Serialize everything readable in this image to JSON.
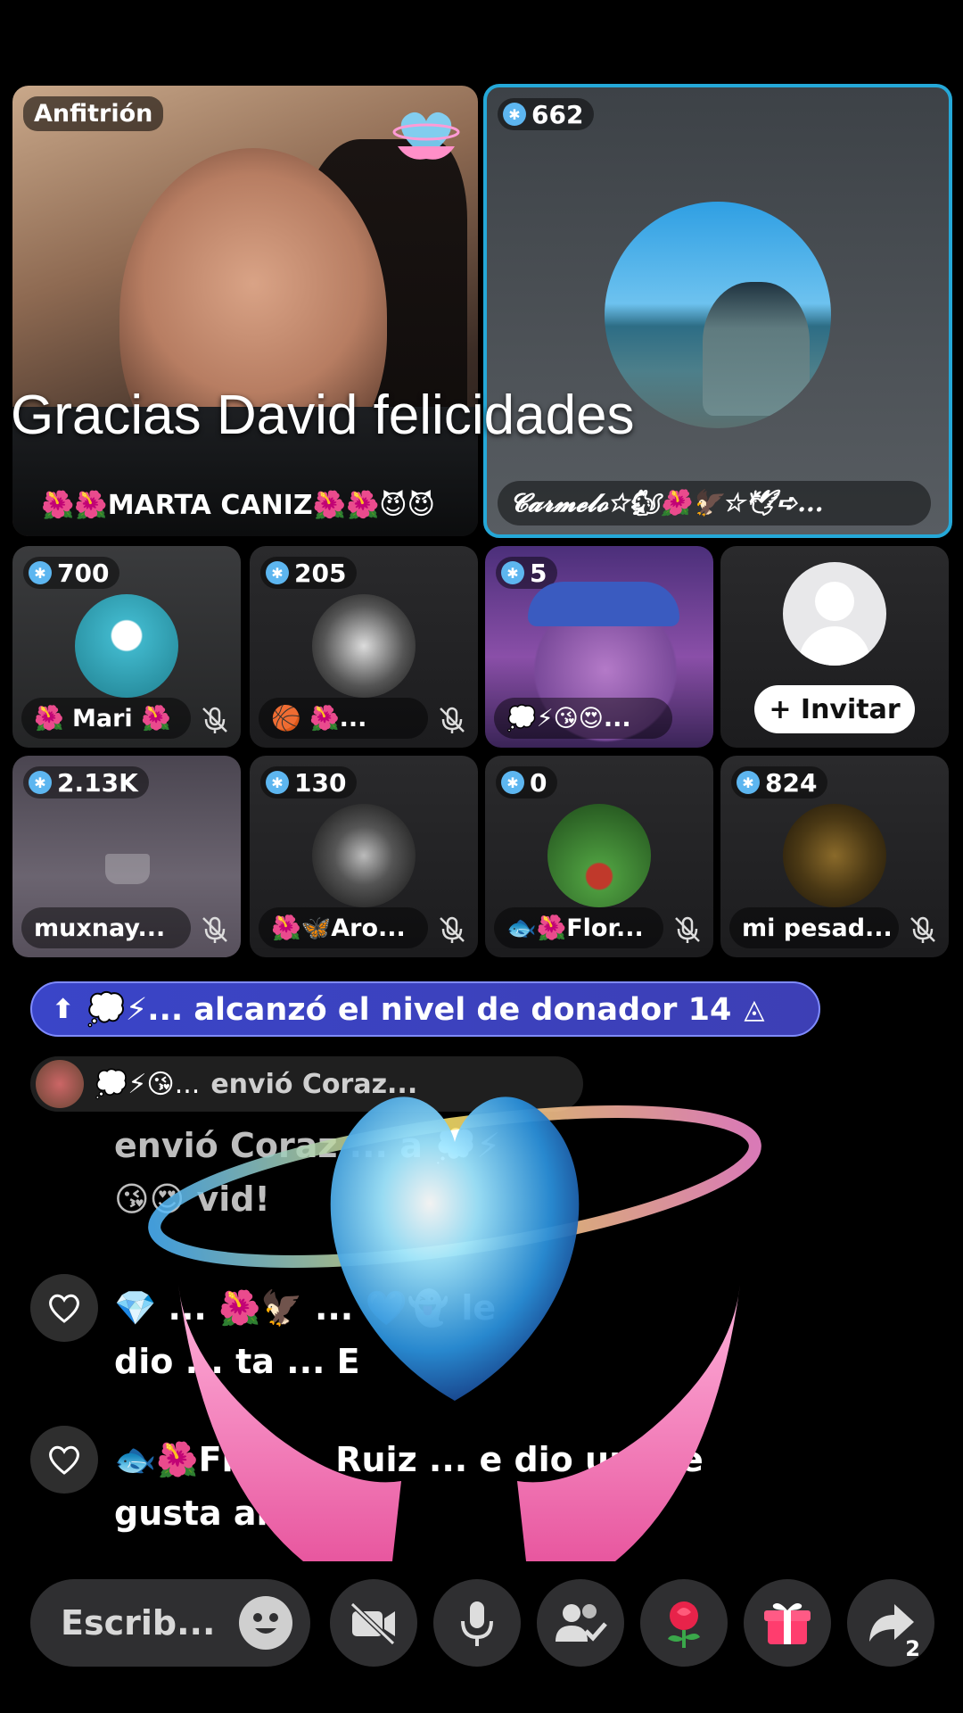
{
  "overlay_text": "Gracias David felicidades",
  "host": {
    "tag": "Anfitrión",
    "name": "🌺🌺MARTA CANIZ🌺🌺😈😈"
  },
  "cohost": {
    "score": "662",
    "name": "𝓒𝓪𝓻𝓶𝓮𝓵𝓸☆🐿🌺🦅☆🕊➪..."
  },
  "guests": [
    {
      "score": "700",
      "name": "🌺 Mari 🌺",
      "avatar_colors": [
        "#3fb5c9",
        "#1f7f8f"
      ]
    },
    {
      "score": "205",
      "name": "🏀 🌺...",
      "avatar_colors": [
        "#eeeeee",
        "#222222"
      ]
    },
    {
      "score": "5",
      "name": "💭⚡😘😍...",
      "avatar_colors": [
        "#6a3fb0",
        "#2a1a50"
      ]
    },
    {
      "invite_label": "+ Invitar"
    },
    {
      "score": "2.13K",
      "name": "muxnay...",
      "avatar_colors": [
        "#6b6470",
        "#4a4550"
      ]
    },
    {
      "score": "130",
      "name": "🌺🦋Aro...",
      "avatar_colors": [
        "#3a3a3a",
        "#0d0d0d"
      ]
    },
    {
      "score": "0",
      "name": "🐟🌺Flor...",
      "avatar_colors": [
        "#4c9a3e",
        "#1e4a1a"
      ]
    },
    {
      "score": "824",
      "name": "mi pesad...",
      "avatar_colors": [
        "#6b5520",
        "#1a140a"
      ]
    }
  ],
  "donor_banner": "💭⚡... alcanzó el nivel de donador 14",
  "gift_notice": {
    "user": "💭⚡😘...",
    "text": "envió Coraz..."
  },
  "chat": [
    {
      "text": "envió Coraz ... a 💭⚡",
      "line2": "😘😍 vid!"
    },
    {
      "text": "💎 ... 🌺🦅 ... 💙👻 le",
      "line2": "dio ... ta ... E"
    },
    {
      "text": "🐟🌺Flor ... Ruiz ... e dio un me",
      "line2": "gusta al LIV"
    }
  ],
  "composer": {
    "placeholder": "Escrib..."
  },
  "share_count": "2",
  "colors": {
    "cohost_border": "#25a8d8",
    "banner": "#3a45c8"
  }
}
